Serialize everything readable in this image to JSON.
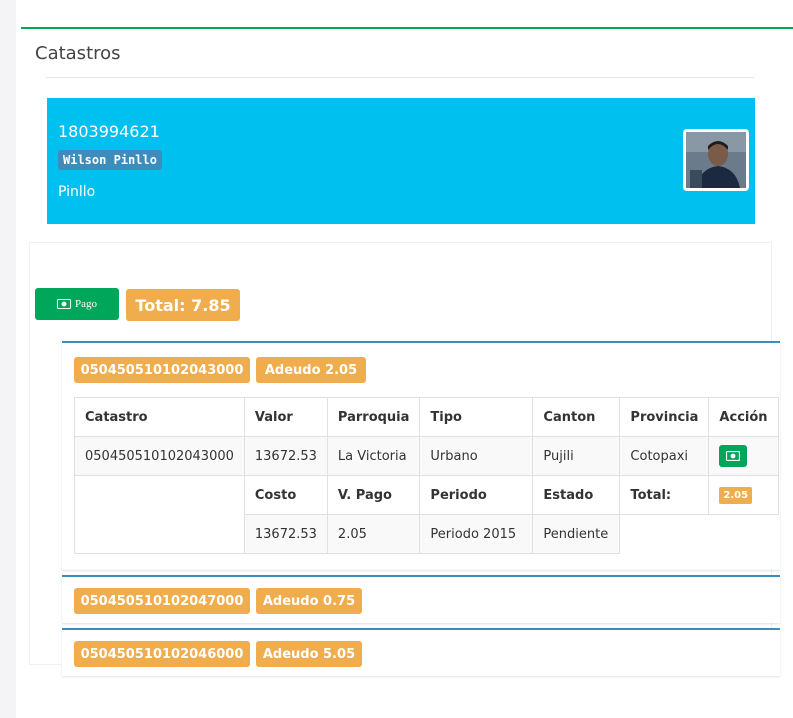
{
  "card": {
    "title": "Catastros"
  },
  "profile": {
    "id": "1803994621",
    "name": "Wilson Pinllo",
    "subtitle": "Pinllo"
  },
  "summary": {
    "pago_label": "Pago",
    "total_label": "Total: 7.85"
  },
  "accordions": [
    {
      "code": "050450510102043000",
      "adeudo": "Adeudo 2.05"
    },
    {
      "code": "050450510102047000",
      "adeudo": "Adeudo 0.75"
    },
    {
      "code": "050450510102046000",
      "adeudo": "Adeudo 5.05"
    }
  ],
  "table": {
    "headers": [
      "Catastro",
      "Valor",
      "Parroquia",
      "Tipo",
      "Canton",
      "Provincia",
      "Acción"
    ],
    "row": [
      "050450510102043000",
      "13672.53",
      "La Victoria",
      "Urbano",
      "Pujili",
      "Cotopaxi"
    ],
    "subheaders": [
      "Costo",
      "V. Pago",
      "Periodo",
      "Estado",
      "Total:"
    ],
    "subtotal": "2.05",
    "subrow": [
      "13672.53",
      "2.05",
      "Periodo 2015",
      "Pendiente"
    ]
  },
  "colors": {
    "success": "#00a65a",
    "warning": "#f0ad4e",
    "info": "#00c0ef",
    "primary": "#3c8dbc"
  },
  "icons": {
    "pay": "money-icon"
  }
}
